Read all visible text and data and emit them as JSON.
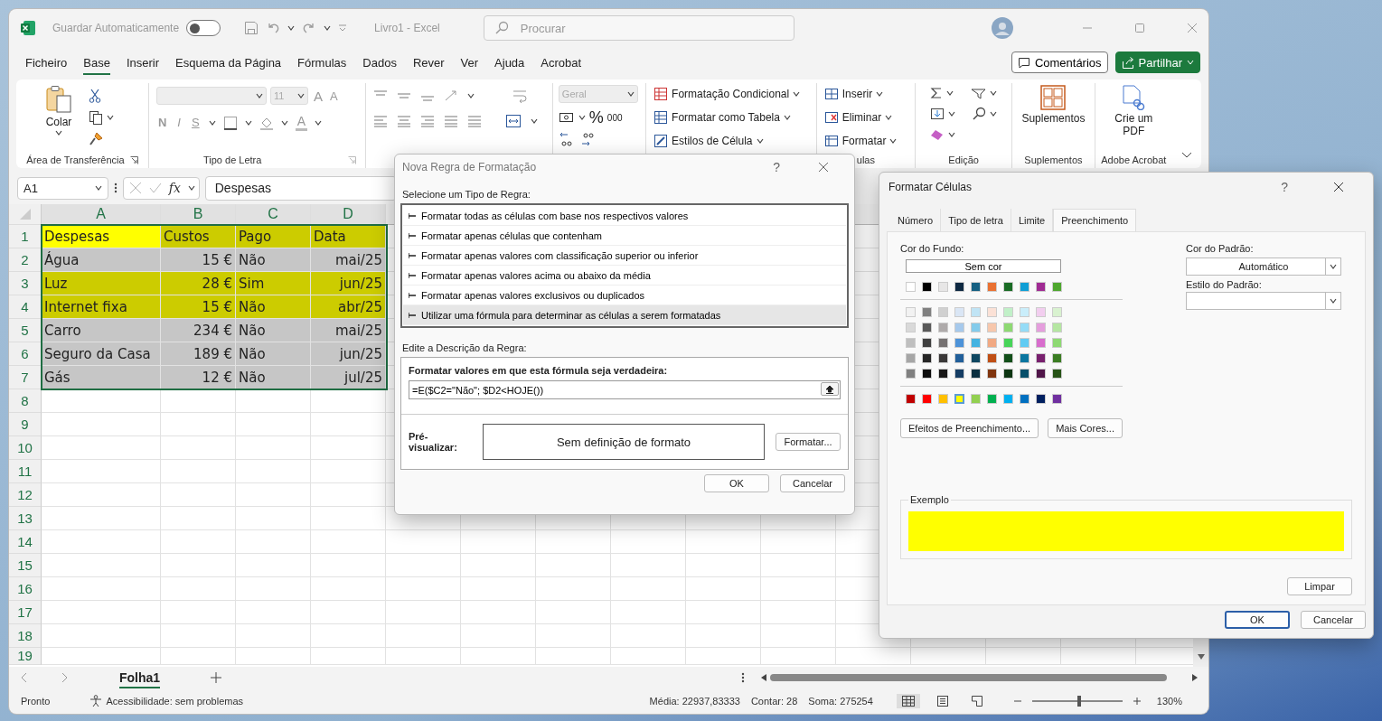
{
  "window": {
    "autosave_label": "Guardar Automaticamente",
    "autosave_on": false,
    "title": "Livro1  -  Excel",
    "search_placeholder": "Procurar"
  },
  "menu_tabs": [
    {
      "label": "Ficheiro",
      "selected": false
    },
    {
      "label": "Base",
      "selected": true
    },
    {
      "label": "Inserir",
      "selected": false
    },
    {
      "label": "Esquema da Página",
      "selected": false
    },
    {
      "label": "Fórmulas",
      "selected": false
    },
    {
      "label": "Dados",
      "selected": false
    },
    {
      "label": "Rever",
      "selected": false
    },
    {
      "label": "Ver",
      "selected": false
    },
    {
      "label": "Ajuda",
      "selected": false
    },
    {
      "label": "Acrobat",
      "selected": false
    }
  ],
  "header_buttons": {
    "comments": "Comentários",
    "share": "Partilhar"
  },
  "ribbon": {
    "clipboard": {
      "paste": "Colar",
      "label": "Área de Transferência"
    },
    "font": {
      "size": "11",
      "grow": "A",
      "shrink": "A",
      "bold": "N",
      "italic": "I",
      "underline": "S",
      "font_color": "A",
      "label": "Tipo de Letra"
    },
    "number": {
      "format": "Geral",
      "percent": "%",
      "thousands": "000"
    },
    "styles": [
      "Formatação Condicional",
      "Formatar como Tabela",
      "Estilos de Célula"
    ],
    "cells": {
      "items": [
        "Inserir",
        "Eliminar",
        "Formatar"
      ],
      "label": "ulas"
    },
    "editing": {
      "label": "Edição"
    },
    "addins": {
      "button": "Suplementos",
      "label": "Suplementos"
    },
    "acrobat": {
      "button": "Crie um PDF",
      "label": "Adobe Acrobat"
    }
  },
  "formula_bar": {
    "name_box": "A1",
    "fx": "fx",
    "value": "Despesas"
  },
  "sheet": {
    "columns": [
      "A",
      "B",
      "C",
      "D"
    ],
    "rows": [
      {
        "number": "1",
        "highlighted": true,
        "selected": true,
        "cells": [
          {
            "text": "Despesas",
            "kind": "text",
            "active": true
          },
          {
            "text": "Custos",
            "kind": "text",
            "active": false
          },
          {
            "text": "Pago",
            "kind": "text",
            "active": false
          },
          {
            "text": "Data",
            "kind": "text",
            "active": false
          }
        ]
      },
      {
        "number": "2",
        "highlighted": false,
        "selected": true,
        "cells": [
          {
            "text": "Água",
            "kind": "text",
            "active": false
          },
          {
            "text": "15 €",
            "kind": "number",
            "active": false
          },
          {
            "text": "Não",
            "kind": "text",
            "active": false
          },
          {
            "text": "mai/25",
            "kind": "number",
            "active": false
          }
        ]
      },
      {
        "number": "3",
        "highlighted": true,
        "selected": true,
        "cells": [
          {
            "text": "Luz",
            "kind": "text",
            "active": false
          },
          {
            "text": "28 €",
            "kind": "number",
            "active": false
          },
          {
            "text": "Sim",
            "kind": "text",
            "active": false
          },
          {
            "text": "jun/25",
            "kind": "number",
            "active": false
          }
        ]
      },
      {
        "number": "4",
        "highlighted": true,
        "selected": true,
        "cells": [
          {
            "text": "Internet fixa",
            "kind": "text",
            "active": false
          },
          {
            "text": "15 €",
            "kind": "number",
            "active": false
          },
          {
            "text": "Não",
            "kind": "text",
            "active": false
          },
          {
            "text": "abr/25",
            "kind": "number",
            "active": false
          }
        ]
      },
      {
        "number": "5",
        "highlighted": false,
        "selected": true,
        "cells": [
          {
            "text": "Carro",
            "kind": "text",
            "active": false
          },
          {
            "text": "234 €",
            "kind": "number",
            "active": false
          },
          {
            "text": "Não",
            "kind": "text",
            "active": false
          },
          {
            "text": "mai/25",
            "kind": "number",
            "active": false
          }
        ]
      },
      {
        "number": "6",
        "highlighted": false,
        "selected": true,
        "cells": [
          {
            "text": "Seguro da Casa",
            "kind": "text",
            "active": false
          },
          {
            "text": "189 €",
            "kind": "number",
            "active": false
          },
          {
            "text": "Não",
            "kind": "text",
            "active": false
          },
          {
            "text": "jun/25",
            "kind": "number",
            "active": false
          }
        ]
      },
      {
        "number": "7",
        "highlighted": false,
        "selected": true,
        "cells": [
          {
            "text": "Gás",
            "kind": "text",
            "active": false
          },
          {
            "text": "12 €",
            "kind": "number",
            "active": false
          },
          {
            "text": "Não",
            "kind": "text",
            "active": false
          },
          {
            "text": "jul/25",
            "kind": "number",
            "active": false
          }
        ]
      }
    ],
    "empty_rows": [
      "8",
      "9",
      "10",
      "11",
      "12",
      "13",
      "14",
      "15",
      "16",
      "17",
      "18",
      "19"
    ]
  },
  "sheet_tabs": [
    {
      "label": "Folha1",
      "selected": true
    }
  ],
  "status_bar": {
    "mode": "Pronto",
    "accessibility": "Acessibilidade: sem problemas",
    "average": "Média: 22937,83333",
    "count": "Contar: 28",
    "sum": "Soma: 275254",
    "views": [
      {
        "kind": "normal",
        "selected": true
      },
      {
        "kind": "page_layout",
        "selected": false
      },
      {
        "kind": "page_break",
        "selected": false
      }
    ],
    "zoom_slider": {
      "level": 0.52
    },
    "zoom": "130%"
  },
  "rule_dialog": {
    "title": "Nova Regra de Formatação",
    "help": "?",
    "type_label": "Selecione um Tipo de Regra:",
    "rule_types": [
      {
        "label": "Formatar todas as células com base nos respectivos valores",
        "selected": false
      },
      {
        "label": "Formatar apenas células que contenham",
        "selected": false
      },
      {
        "label": "Formatar apenas valores com classificação superior ou inferior",
        "selected": false
      },
      {
        "label": "Formatar apenas valores acima ou abaixo da média",
        "selected": false
      },
      {
        "label": "Formatar apenas valores exclusivos ou duplicados",
        "selected": false
      },
      {
        "label": "Utilizar uma fórmula para determinar as células a serem formatadas",
        "selected": true
      }
    ],
    "description_label": "Edite a Descrição da Regra:",
    "formula_label": "Formatar valores em que esta fórmula seja verdadeira:",
    "formula": "=E($C2=\"Não\"; $D2<HOJE())",
    "preview_label": "Pré-visualizar:",
    "preview": "Sem definição de formato",
    "format_button": "Formatar...",
    "ok": "OK",
    "cancel": "Cancelar"
  },
  "format_dialog": {
    "title": "Formatar Células",
    "help": "?",
    "tabs": [
      {
        "label": "Número",
        "selected": false
      },
      {
        "label": "Tipo de letra",
        "selected": false
      },
      {
        "label": "Limite",
        "selected": false
      },
      {
        "label": "Preenchimento",
        "selected": true
      }
    ],
    "background_label": "Cor do Fundo:",
    "no_color": "Sem cor",
    "theme_colors": [
      {
        "color": "#ffffff",
        "selected": false
      },
      {
        "color": "#000000",
        "selected": false
      },
      {
        "color": "#e7e6e6",
        "selected": false
      },
      {
        "color": "#0e2841",
        "selected": false
      },
      {
        "color": "#156082",
        "selected": false
      },
      {
        "color": "#e97132",
        "selected": false
      },
      {
        "color": "#196b24",
        "selected": false
      },
      {
        "color": "#0f9ed5",
        "selected": false
      },
      {
        "color": "#a02b93",
        "selected": false
      },
      {
        "color": "#4ea72e",
        "selected": false
      }
    ],
    "tints": [
      [
        {
          "color": "#f2f2f2",
          "selected": false
        },
        {
          "color": "#808080",
          "selected": false
        },
        {
          "color": "#d0d0d0",
          "selected": false
        },
        {
          "color": "#dae6f5",
          "selected": false
        },
        {
          "color": "#c0e4f5",
          "selected": false
        },
        {
          "color": "#fbe1d6",
          "selected": false
        },
        {
          "color": "#c1f0c8",
          "selected": false
        },
        {
          "color": "#caeefb",
          "selected": false
        },
        {
          "color": "#f2ceef",
          "selected": false
        },
        {
          "color": "#d9f2d0",
          "selected": false
        }
      ],
      [
        {
          "color": "#d9d9d9",
          "selected": false
        },
        {
          "color": "#595959",
          "selected": false
        },
        {
          "color": "#aeaaaa",
          "selected": false
        },
        {
          "color": "#a6c9ec",
          "selected": false
        },
        {
          "color": "#83cbeb",
          "selected": false
        },
        {
          "color": "#f7c7ac",
          "selected": false
        },
        {
          "color": "#8ed973",
          "selected": false
        },
        {
          "color": "#95dcf7",
          "selected": false
        },
        {
          "color": "#e59edd",
          "selected": false
        },
        {
          "color": "#b5e6a2",
          "selected": false
        }
      ],
      [
        {
          "color": "#bfbfbf",
          "selected": false
        },
        {
          "color": "#404040",
          "selected": false
        },
        {
          "color": "#757171",
          "selected": false
        },
        {
          "color": "#4d93d9",
          "selected": false
        },
        {
          "color": "#44b3e1",
          "selected": false
        },
        {
          "color": "#f1a983",
          "selected": false
        },
        {
          "color": "#47d459",
          "selected": false
        },
        {
          "color": "#60cbf3",
          "selected": false
        },
        {
          "color": "#d86dcd",
          "selected": false
        },
        {
          "color": "#8ed973",
          "selected": false
        }
      ],
      [
        {
          "color": "#a6a6a6",
          "selected": false
        },
        {
          "color": "#262626",
          "selected": false
        },
        {
          "color": "#3a3838",
          "selected": false
        },
        {
          "color": "#215f9a",
          "selected": false
        },
        {
          "color": "#0f4761",
          "selected": false
        },
        {
          "color": "#c04f15",
          "selected": false
        },
        {
          "color": "#124f1a",
          "selected": false
        },
        {
          "color": "#0b76a0",
          "selected": false
        },
        {
          "color": "#78206e",
          "selected": false
        },
        {
          "color": "#3b7d23",
          "selected": false
        }
      ],
      [
        {
          "color": "#808080",
          "selected": false
        },
        {
          "color": "#0d0d0d",
          "selected": false
        },
        {
          "color": "#171616",
          "selected": false
        },
        {
          "color": "#153d64",
          "selected": false
        },
        {
          "color": "#0a2f40",
          "selected": false
        },
        {
          "color": "#80350e",
          "selected": false
        },
        {
          "color": "#0d3512",
          "selected": false
        },
        {
          "color": "#074f6a",
          "selected": false
        },
        {
          "color": "#501549",
          "selected": false
        },
        {
          "color": "#275317",
          "selected": false
        }
      ]
    ],
    "standard_colors": [
      {
        "color": "#c00000",
        "selected": false
      },
      {
        "color": "#ff0000",
        "selected": false
      },
      {
        "color": "#ffc000",
        "selected": false
      },
      {
        "color": "#ffff00",
        "selected": true
      },
      {
        "color": "#92d050",
        "selected": false
      },
      {
        "color": "#00b050",
        "selected": false
      },
      {
        "color": "#00b0f0",
        "selected": false
      },
      {
        "color": "#0070c0",
        "selected": false
      },
      {
        "color": "#002060",
        "selected": false
      },
      {
        "color": "#7030a0",
        "selected": false
      }
    ],
    "effects_button": "Efeitos de Preenchimento...",
    "more_colors_button": "Mais Cores...",
    "pattern_color_label": "Cor do Padrão:",
    "pattern_color": "Automático",
    "pattern_style_label": "Estilo do Padrão:",
    "sample_label": "Exemplo",
    "clear_button": "Limpar",
    "ok": "OK",
    "cancel": "Cancelar"
  }
}
